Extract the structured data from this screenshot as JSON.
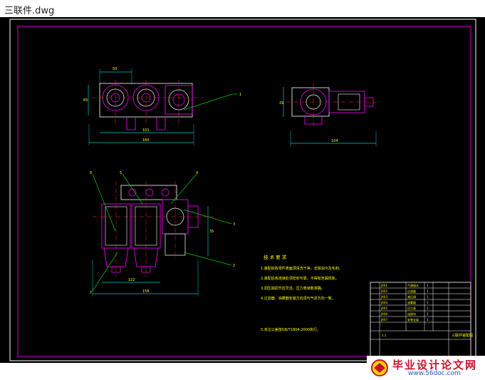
{
  "window": {
    "title": "三联件.dwg"
  },
  "colors": {
    "background": "#000000",
    "frame": "#d000d0",
    "outline": "#ffffff",
    "part": "#ff00ff",
    "center": "#ff3030",
    "leader": "#00d000",
    "dim": "#00c8c8",
    "text": "#ffff00"
  },
  "dimensions": {
    "top_width": "50",
    "left_height": "65",
    "mid_width": "101",
    "overall_width": "160",
    "side_height": "29",
    "side_width": "104",
    "front_width_a": "122",
    "front_width_b": "156",
    "front_height": "35"
  },
  "callouts": {
    "top_view": [
      "1"
    ],
    "front_view": [
      "8",
      "5",
      "4",
      "3",
      "2",
      "7"
    ]
  },
  "tech_requirements": {
    "title": "技 术 要 求",
    "items": [
      "1.装配前各零件表面须清洗干净，去除油污及毛刺。",
      "2.装配后各连接处须密封可靠，不得有泄漏现象。",
      "3.调压阀调节应灵活，压力表读数准确。",
      "4.过滤器、油雾器安装方向须与气流方向一致。",
      "5.未注公差按GB/T1804-2000执行。"
    ]
  },
  "title_block": {
    "rows": [
      [
        "JX01",
        "气源接头",
        "1"
      ],
      [
        "JX02",
        "过滤器",
        "1"
      ],
      [
        "JX03",
        "减压阀",
        "1"
      ],
      [
        "JX04",
        "油雾器",
        "1"
      ],
      [
        "JX05",
        "压力表",
        "1"
      ],
      [
        "JX06",
        "连接块",
        "2"
      ],
      [
        "JX07",
        "安装支架",
        "1"
      ]
    ],
    "drawing_title": "三联件装配图",
    "material": "",
    "scale": "1:1"
  },
  "watermark": {
    "text": "毕业设计论文网",
    "url": "www.56doc.com"
  }
}
